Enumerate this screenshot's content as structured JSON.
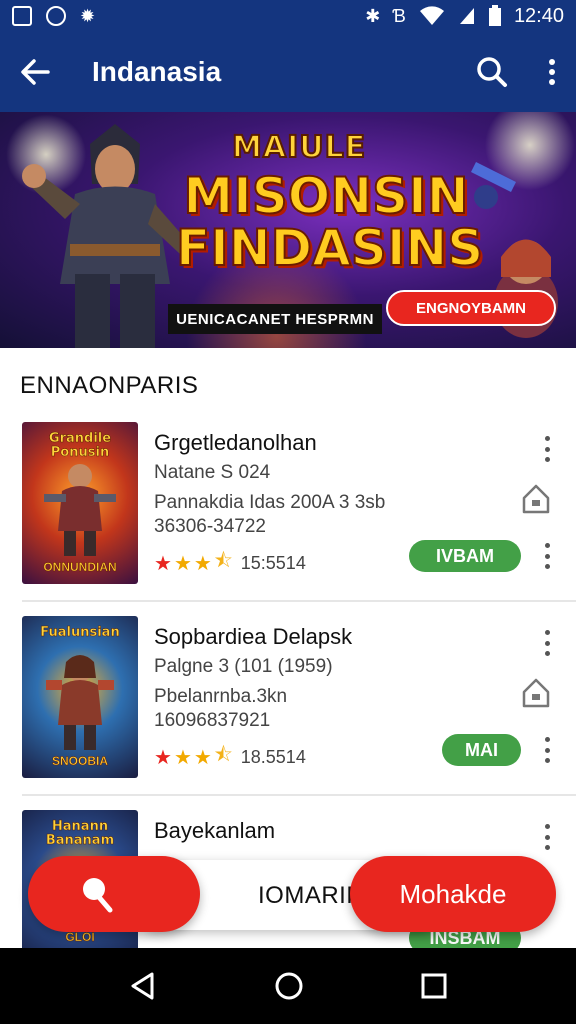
{
  "status_bar": {
    "time": "12:40"
  },
  "app_bar": {
    "title": "Indanasia",
    "icons": [
      "back-arrow-icon",
      "search-icon",
      "more-vert-icon"
    ]
  },
  "hero": {
    "title_small": "MAIULE",
    "title_line1": "MISONSIN",
    "title_line2": "FINDASINS",
    "tagline": "UENICACANET HESPRMN",
    "cta": "ENGNOYBAMN"
  },
  "section": {
    "title": "ENNAONPARIS"
  },
  "items": [
    {
      "title": "Grgetledanolhan",
      "sub1": "Natane S 024",
      "sub2": "Pannakdia Idas 200A 3 3sb",
      "sub3": "36306-34722",
      "rating": "15:5514",
      "action": "IVBAM",
      "thumb_top": "Grandile Ponusin",
      "thumb_bottom": "ONNUNDIAN"
    },
    {
      "title": "Sopbardiea Delapsk",
      "sub1": "Palgne 3 (101 (1959)",
      "sub2": "Pbelanrnba.3kn",
      "sub3": "16096837921",
      "rating": "18.5514",
      "action": "MAI",
      "thumb_top": "Fualunsian",
      "thumb_bottom": "SNOOBIA"
    },
    {
      "title": "Bayekanlam",
      "thumb_top": "Hanann Bananam",
      "thumb_bottom": "GLOI",
      "action": "INSBAM"
    }
  ],
  "bottom_actions": {
    "middle_label": "IOMARIRNEHA",
    "right_label": "Mohakde"
  },
  "colors": {
    "app_bar": "#14357f",
    "accent_red": "#e8261f",
    "pill_green": "#43a047",
    "star": "#f2a900"
  }
}
